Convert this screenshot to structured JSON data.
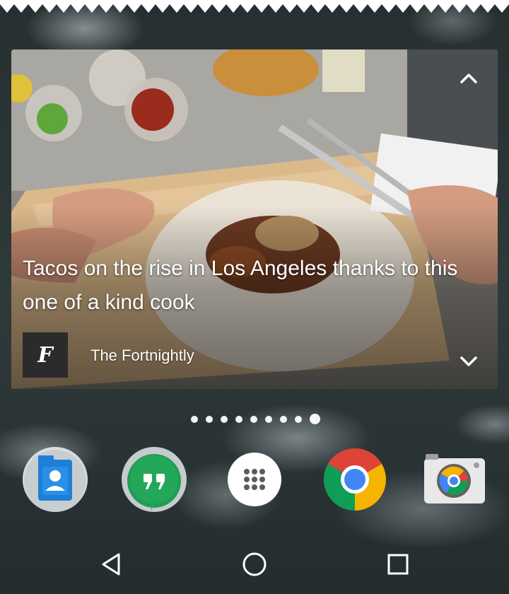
{
  "card": {
    "headline": "Tacos on the rise in Los Angeles thanks to this one of a kind cook",
    "source_logo_letter": "F",
    "source_name": "The Fortnightly"
  },
  "pager": {
    "total": 9,
    "active": 9
  },
  "dock": {
    "apps": [
      {
        "name": "Contacts",
        "icon": "contacts-icon"
      },
      {
        "name": "Hangouts",
        "icon": "hangouts-icon"
      },
      {
        "name": "Apps",
        "icon": "app-drawer-icon"
      },
      {
        "name": "Chrome",
        "icon": "chrome-icon"
      },
      {
        "name": "Camera",
        "icon": "camera-icon"
      }
    ]
  },
  "navigation": [
    "back",
    "home",
    "recents"
  ]
}
